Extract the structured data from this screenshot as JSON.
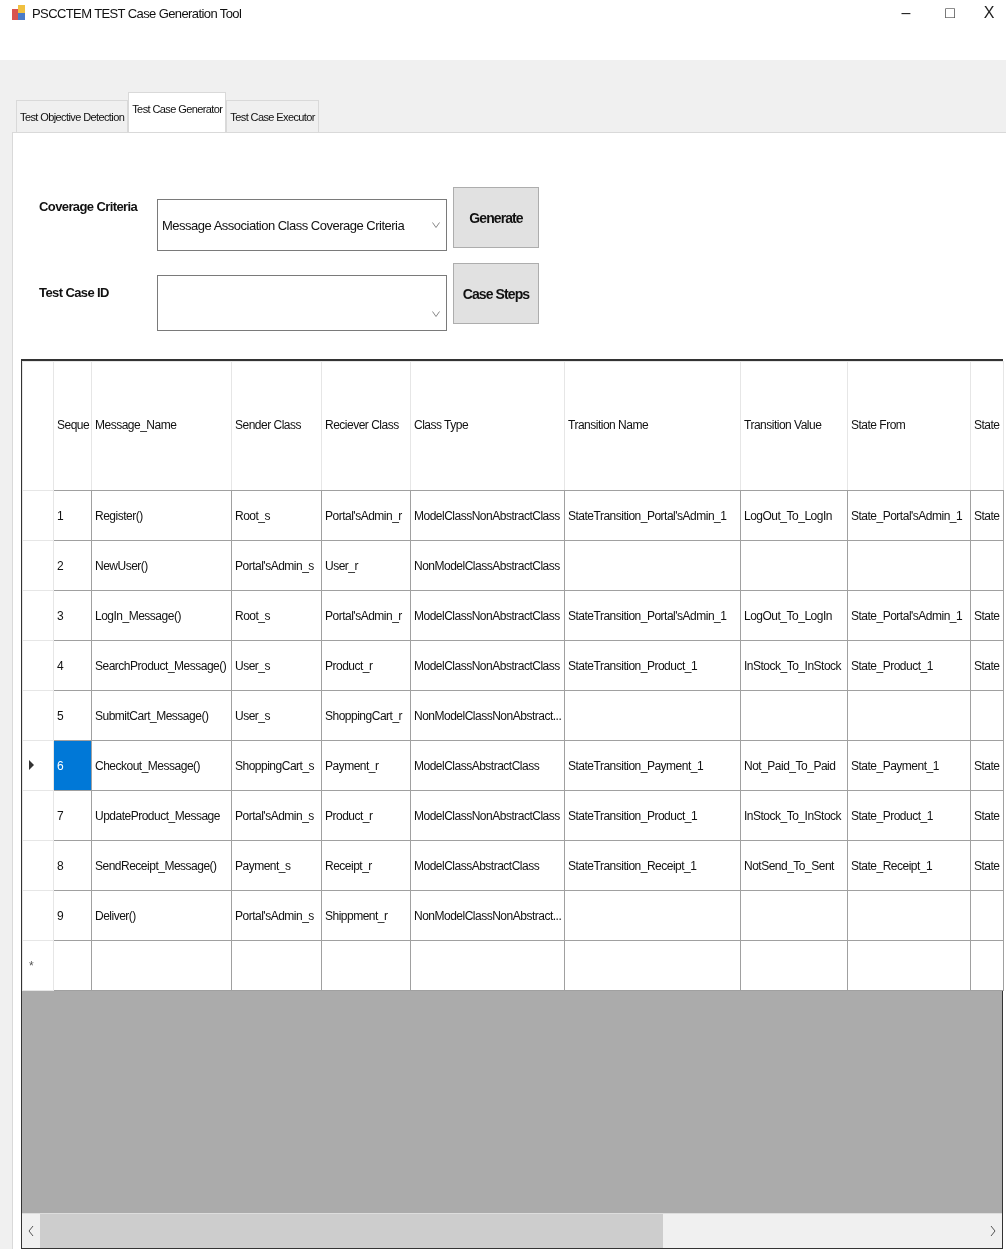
{
  "window": {
    "title": "PSCCTEM TEST Case Generation Tool",
    "controls": [
      {
        "kind": "minimize",
        "label": "–"
      },
      {
        "kind": "maximize",
        "label": "□"
      },
      {
        "kind": "close",
        "label": "X"
      }
    ]
  },
  "tabs": [
    {
      "label": "Test Objective Detection",
      "selected": false
    },
    {
      "label": "Test Case Generator",
      "selected": true
    },
    {
      "label": "Test Case Executor",
      "selected": false
    }
  ],
  "form": {
    "coverage_label": "Coverage Criteria",
    "coverage_value": "Message Association Class Coverage Criteria",
    "generate_button": "Generate",
    "test_case_label": "Test Case ID",
    "case_steps_button": "Case Steps"
  },
  "table": {
    "columns": [
      "Seque",
      "Message_Name",
      "Sender Class",
      "Reciever Class",
      "Class Type",
      "Transition Name",
      "Transition Value",
      "State From",
      "State"
    ],
    "rows": [
      {
        "selected": false,
        "cells": [
          "1",
          "Register()",
          "Root_s",
          "Portal'sAdmin_r",
          "ModelClassNonAbstractClass",
          "StateTransition_Portal'sAdmin_1",
          "LogOut_To_LogIn",
          "State_Portal'sAdmin_1",
          "State"
        ]
      },
      {
        "selected": false,
        "cells": [
          "2",
          "NewUser()",
          "Portal'sAdmin_s",
          "User_r",
          "NonModelClassAbstractClass",
          "",
          "",
          "",
          ""
        ]
      },
      {
        "selected": false,
        "cells": [
          "3",
          "LogIn_Message()",
          "Root_s",
          "Portal'sAdmin_r",
          "ModelClassNonAbstractClass",
          "StateTransition_Portal'sAdmin_1",
          "LogOut_To_LogIn",
          "State_Portal'sAdmin_1",
          "State"
        ]
      },
      {
        "selected": false,
        "cells": [
          "4",
          "SearchProduct_Message()",
          "User_s",
          "Product_r",
          "ModelClassNonAbstractClass",
          "StateTransition_Product_1",
          "InStock_To_InStock",
          "State_Product_1",
          "State"
        ]
      },
      {
        "selected": false,
        "cells": [
          "5",
          "SubmitCart_Message()",
          "User_s",
          "ShoppingCart_r",
          "NonModelClassNonAbstract...",
          "",
          "",
          "",
          ""
        ]
      },
      {
        "selected": true,
        "cells": [
          "6",
          "Checkout_Message()",
          "ShoppingCart_s",
          "Payment_r",
          "ModelClassAbstractClass",
          "StateTransition_Payment_1",
          "Not_Paid_To_Paid",
          "State_Payment_1",
          "State"
        ]
      },
      {
        "selected": false,
        "cells": [
          "7",
          "UpdateProduct_Message",
          "Portal'sAdmin_s",
          "Product_r",
          "ModelClassNonAbstractClass",
          "StateTransition_Product_1",
          "InStock_To_InStock",
          "State_Product_1",
          "State"
        ]
      },
      {
        "selected": false,
        "cells": [
          "8",
          "SendReceipt_Message()",
          "Payment_s",
          "Receipt_r",
          "ModelClassAbstractClass",
          "StateTransition_Receipt_1",
          "NotSend_To_Sent",
          "State_Receipt_1",
          "State"
        ]
      },
      {
        "selected": false,
        "cells": [
          "9",
          "Deliver()",
          "Portal'sAdmin_s",
          "Shippment_r",
          "NonModelClassNonAbstract...",
          "",
          "",
          "",
          ""
        ]
      }
    ],
    "new_row_marker": "*"
  }
}
